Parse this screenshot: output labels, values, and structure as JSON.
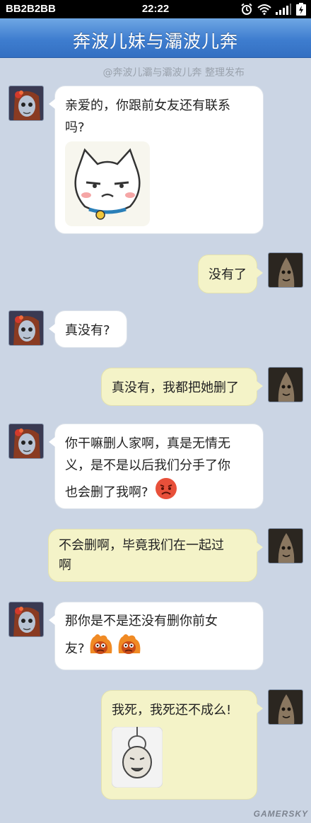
{
  "status_bar": {
    "carrier": "BB2B2BB",
    "time": "22:22"
  },
  "header": {
    "title": "奔波儿妹与灞波儿奔"
  },
  "watermark": {
    "top": "@奔波儿灞与灞波儿奔 整理发布",
    "bottom": "GAMERSKY"
  },
  "colors": {
    "title_bar": "#3e7dcf",
    "background": "#cbd5e4",
    "incoming_bubble": "#ffffff",
    "outgoing_bubble": "#f4f3c8"
  },
  "messages": [
    {
      "from": "her",
      "text": "亲爱的，你跟前女友还有联系吗?",
      "line1": "亲爱的，你跟前女友还有联系",
      "line2": "吗?",
      "sticker": "smug-cat-sticker"
    },
    {
      "from": "him",
      "text": "没有了"
    },
    {
      "from": "her",
      "text": "真没有?"
    },
    {
      "from": "him",
      "text": "真没有，我都把她删了"
    },
    {
      "from": "her",
      "line1": "你干嘛删人家啊，真是无情无",
      "line2": "义，是不是以后我们分手了你",
      "line3": "也会删了我啊?",
      "sticker": "angry-face-emoji"
    },
    {
      "from": "him",
      "line1": "不会删啊，毕竟我们在一起过",
      "line2": "啊"
    },
    {
      "from": "her",
      "line1": "那你是不是还没有删你前女",
      "line2": "友?",
      "sticker": "fiery-monkey-emoji"
    },
    {
      "from": "him",
      "text": "我死，我死还不成么!",
      "sticker": "hanging-meme-sticker"
    }
  ]
}
